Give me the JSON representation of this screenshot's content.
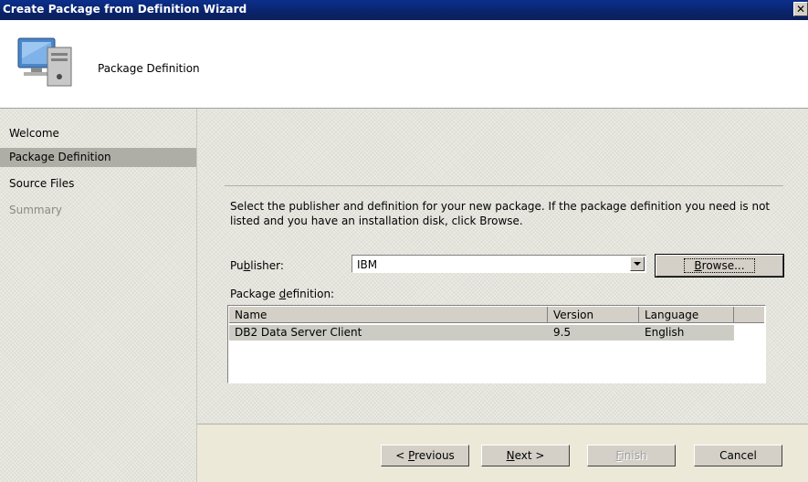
{
  "window": {
    "title": "Create Package from Definition Wizard",
    "close_glyph": "✕"
  },
  "header": {
    "title": "Package Definition",
    "icon": "computer-icon"
  },
  "sidebar": {
    "items": [
      {
        "label": "Welcome",
        "state": "normal"
      },
      {
        "label": "Package Definition",
        "state": "selected"
      },
      {
        "label": "Source Files",
        "state": "normal"
      },
      {
        "label": "Summary",
        "state": "disabled"
      }
    ]
  },
  "main": {
    "instructions": "Select the publisher and definition for your new package. If the package definition you need is not listed and you have an installation disk, click Browse.",
    "publisher_label_pre": "Pu",
    "publisher_label_key": "b",
    "publisher_label_post": "lisher:",
    "publisher_value": "IBM",
    "browse_pre": "",
    "browse_key": "B",
    "browse_post": "rowse...",
    "package_label_pre": "Package ",
    "package_label_key": "d",
    "package_label_post": "efinition:",
    "columns": [
      "Name",
      "Version",
      "Language"
    ],
    "rows": [
      {
        "name": "DB2 Data Server Client",
        "version": "9.5",
        "language": "English"
      }
    ]
  },
  "footer": {
    "previous_pre": "< ",
    "previous_key": "P",
    "previous_post": "revious",
    "next_key": "N",
    "next_post": "ext >",
    "finish_key": "F",
    "finish_post": "inish",
    "cancel": "Cancel"
  }
}
